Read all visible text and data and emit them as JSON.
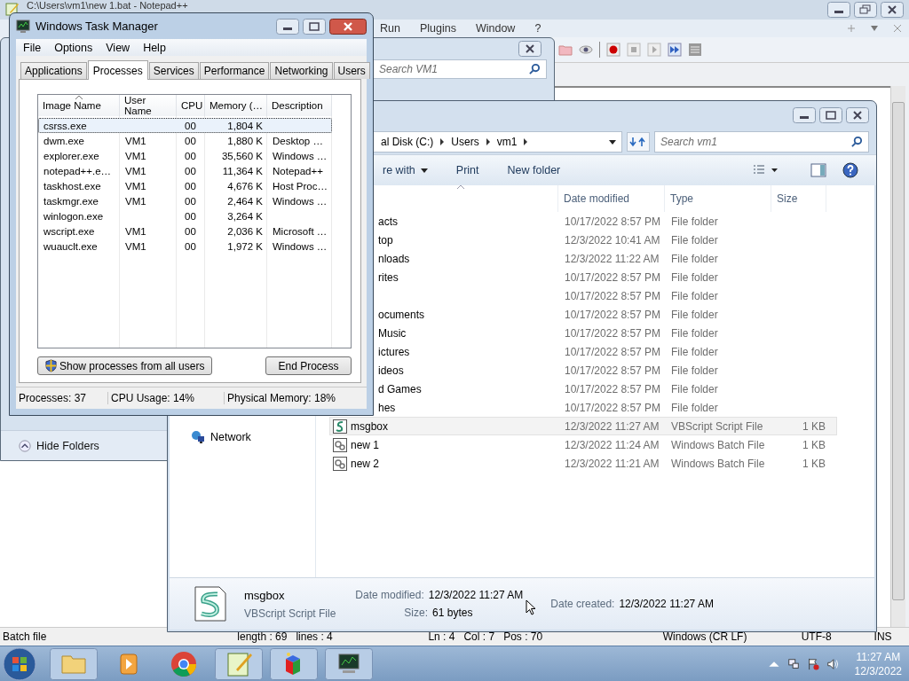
{
  "notepadpp": {
    "title": "C:\\Users\\vm1\\new 1.bat - Notepad++",
    "menu": [
      "Run",
      "Plugins",
      "Window",
      "?"
    ],
    "status": {
      "file_type": "Batch file",
      "length": "length : 69",
      "lines": "lines : 4",
      "ln": "Ln : 4",
      "col": "Col : 7",
      "pos": "Pos : 70",
      "eol": "Windows (CR LF)",
      "encoding": "UTF-8",
      "mode": "INS"
    }
  },
  "back_explorer": {
    "search": {
      "placeholder": "Search VM1"
    },
    "hide_folders": "Hide Folders"
  },
  "explorer": {
    "breadcrumb": [
      "al Disk (C:)",
      "Users",
      "vm1"
    ],
    "search": {
      "placeholder": "Search vm1"
    },
    "toolbar": [
      {
        "label": "re with",
        "dropdown": true
      },
      {
        "label": "Print",
        "dropdown": false
      },
      {
        "label": "New folder",
        "dropdown": false
      }
    ],
    "columns": [
      "Date modified",
      "Type",
      "Size"
    ],
    "nav": [
      "Network"
    ],
    "rows": [
      {
        "kind": "folder",
        "name": "acts",
        "date": "10/17/2022 8:57 PM",
        "type": "File folder",
        "selected": false
      },
      {
        "kind": "folder",
        "name": "top",
        "date": "12/3/2022 10:41 AM",
        "type": "File folder",
        "selected": false
      },
      {
        "kind": "folder",
        "name": "nloads",
        "date": "12/3/2022 11:22 AM",
        "type": "File folder",
        "selected": false
      },
      {
        "kind": "folder",
        "name": "rites",
        "date": "10/17/2022 8:57 PM",
        "type": "File folder",
        "selected": false
      },
      {
        "kind": "folder",
        "date": "10/17/2022 8:57 PM",
        "type": "File folder",
        "selected": false
      },
      {
        "kind": "folder",
        "name": "ocuments",
        "date": "10/17/2022 8:57 PM",
        "type": "File folder",
        "selected": false
      },
      {
        "kind": "folder",
        "name": "Music",
        "date": "10/17/2022 8:57 PM",
        "type": "File folder",
        "selected": false
      },
      {
        "kind": "folder",
        "name": "ictures",
        "date": "10/17/2022 8:57 PM",
        "type": "File folder",
        "selected": false
      },
      {
        "kind": "folder",
        "name": "ideos",
        "date": "10/17/2022 8:57 PM",
        "type": "File folder",
        "selected": false
      },
      {
        "kind": "folder",
        "name": "d Games",
        "date": "10/17/2022 8:57 PM",
        "type": "File folder",
        "selected": false
      },
      {
        "kind": "folder",
        "name": "hes",
        "date": "10/17/2022 8:57 PM",
        "type": "File folder",
        "selected": false
      },
      {
        "kind": "vbscript",
        "name": "msgbox",
        "date": "12/3/2022 11:27 AM",
        "type": "VBScript Script File",
        "size": "1 KB",
        "selected": true
      },
      {
        "kind": "batch",
        "name": "new 1",
        "date": "12/3/2022 11:24 AM",
        "type": "Windows Batch File",
        "size": "1 KB",
        "selected": false
      },
      {
        "kind": "batch",
        "name": "new 2",
        "date": "12/3/2022 11:21 AM",
        "type": "Windows Batch File",
        "size": "1 KB",
        "selected": false
      }
    ],
    "details": {
      "name": "msgbox",
      "type": "VBScript Script File",
      "modified_label": "Date modified:",
      "modified": "12/3/2022 11:27 AM",
      "created_label": "Date created:",
      "created": "12/3/2022 11:27 AM",
      "size_label": "Size:",
      "size": "61 bytes"
    }
  },
  "task_manager": {
    "title": "Windows Task Manager",
    "menu": [
      "File",
      "Options",
      "View",
      "Help"
    ],
    "tabs": [
      {
        "label": "Applications",
        "selected": false
      },
      {
        "label": "Processes",
        "selected": true
      },
      {
        "label": "Services",
        "selected": false
      },
      {
        "label": "Performance",
        "selected": false
      },
      {
        "label": "Networking",
        "selected": false
      },
      {
        "label": "Users",
        "selected": false
      }
    ],
    "columns": [
      "Image Name",
      "User Name",
      "CPU",
      "Memory (…",
      "Description"
    ],
    "rows": [
      {
        "image": "csrss.exe",
        "cpu": "00",
        "memory": "1,804 K",
        "selected": true
      },
      {
        "image": "dwm.exe",
        "user": "VM1",
        "cpu": "00",
        "memory": "1,880 K",
        "description": "Desktop …",
        "selected": false
      },
      {
        "image": "explorer.exe",
        "user": "VM1",
        "cpu": "00",
        "memory": "35,560 K",
        "description": "Windows …",
        "selected": false
      },
      {
        "image": "notepad++.e…",
        "user": "VM1",
        "cpu": "00",
        "memory": "11,364 K",
        "description": "Notepad++",
        "selected": false
      },
      {
        "image": "taskhost.exe",
        "user": "VM1",
        "cpu": "00",
        "memory": "4,676 K",
        "description": "Host Proc…",
        "selected": false
      },
      {
        "image": "taskmgr.exe",
        "user": "VM1",
        "cpu": "00",
        "memory": "2,464 K",
        "description": "Windows …",
        "selected": false
      },
      {
        "image": "winlogon.exe",
        "cpu": "00",
        "memory": "3,264 K",
        "selected": false
      },
      {
        "image": "wscript.exe",
        "user": "VM1",
        "cpu": "00",
        "memory": "2,036 K",
        "description": "Microsoft …",
        "selected": false
      },
      {
        "image": "wuauclt.exe",
        "user": "VM1",
        "cpu": "00",
        "memory": "1,972 K",
        "description": "Windows …",
        "selected": false
      }
    ],
    "buttons": [
      "Show processes from all users",
      "End Process"
    ],
    "status": [
      "Processes: 37",
      "CPU Usage: 14%",
      "Physical Memory: 18%"
    ]
  },
  "taskbar": {
    "time": "11:27 AM",
    "date": "12/3/2022"
  }
}
